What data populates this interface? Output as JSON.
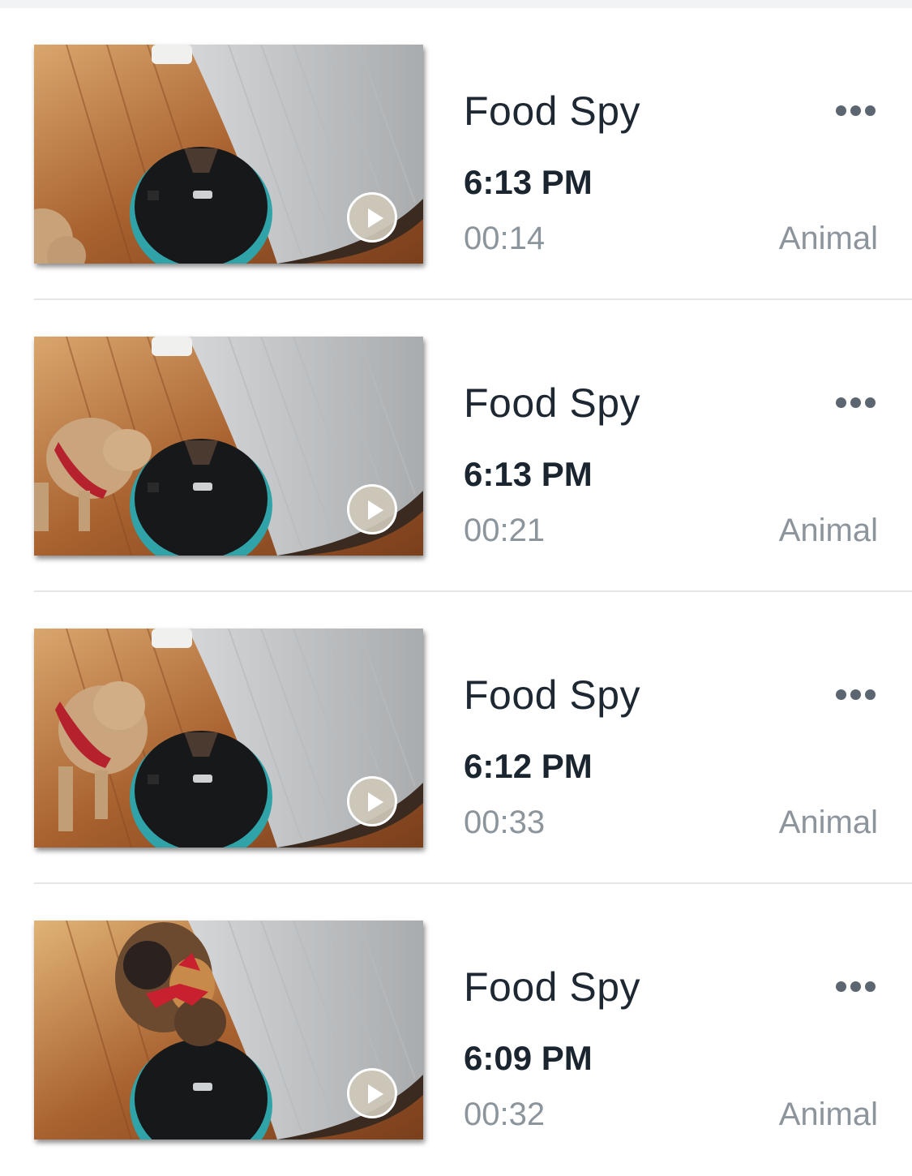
{
  "recordings": [
    {
      "title": "Food Spy",
      "time": "6:13 PM",
      "duration": "00:14",
      "category": "Animal",
      "thumbnail_subject": "dog-tail",
      "more_icon": "ellipsis-icon"
    },
    {
      "title": "Food Spy",
      "time": "6:13 PM",
      "duration": "00:21",
      "category": "Animal",
      "thumbnail_subject": "dog",
      "more_icon": "ellipsis-icon"
    },
    {
      "title": "Food Spy",
      "time": "6:12 PM",
      "duration": "00:33",
      "category": "Animal",
      "thumbnail_subject": "dog",
      "more_icon": "ellipsis-icon"
    },
    {
      "title": "Food Spy",
      "time": "6:09 PM",
      "duration": "00:32",
      "category": "Animal",
      "thumbnail_subject": "cat",
      "more_icon": "ellipsis-icon"
    }
  ],
  "colors": {
    "title": "#1e2833",
    "secondary_text": "#8c949c",
    "divider": "#e4e6e8",
    "feeder_teal": "#2fa3a8"
  }
}
